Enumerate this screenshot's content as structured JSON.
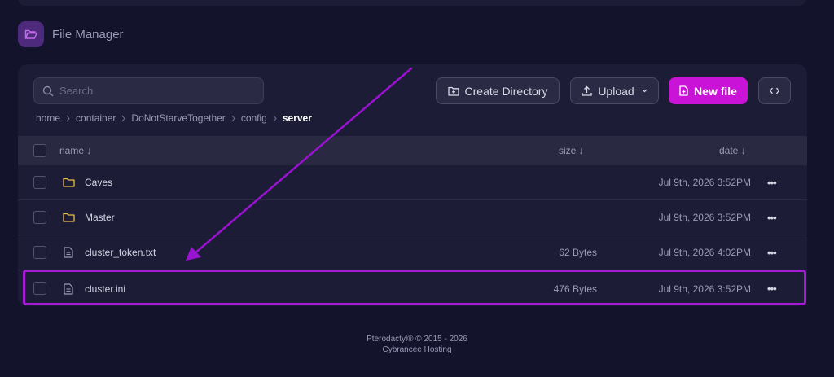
{
  "section": {
    "title": "File Manager",
    "icon": "folder-open-icon"
  },
  "toolbar": {
    "search_placeholder": "Search",
    "create_directory_label": "Create Directory",
    "upload_label": "Upload",
    "new_file_label": "New file"
  },
  "breadcrumb": {
    "items": [
      "home",
      "container",
      "DoNotStarveTogether",
      "config"
    ],
    "current": "server"
  },
  "table": {
    "headers": {
      "name": "name ↓",
      "size": "size ↓",
      "date": "date ↓"
    },
    "rows": [
      {
        "type": "folder",
        "name": "Caves",
        "size": "",
        "date": "Jul 9th, 2026 3:52PM"
      },
      {
        "type": "folder",
        "name": "Master",
        "size": "",
        "date": "Jul 9th, 2026 3:52PM"
      },
      {
        "type": "file",
        "name": "cluster_token.txt",
        "size": "62 Bytes",
        "date": "Jul 9th, 2026 4:02PM"
      },
      {
        "type": "file",
        "name": "cluster.ini",
        "size": "476 Bytes",
        "date": "Jul 9th, 2026 3:52PM"
      }
    ],
    "more_label": "•••"
  },
  "footer": {
    "line1": "Pterodactyl® © 2015 - 2026",
    "line2": "Cybrancee Hosting"
  },
  "colors": {
    "accent": "#c913d6",
    "highlight": "#a61ad6",
    "background": "#14132c",
    "panel": "#1d1c36"
  }
}
